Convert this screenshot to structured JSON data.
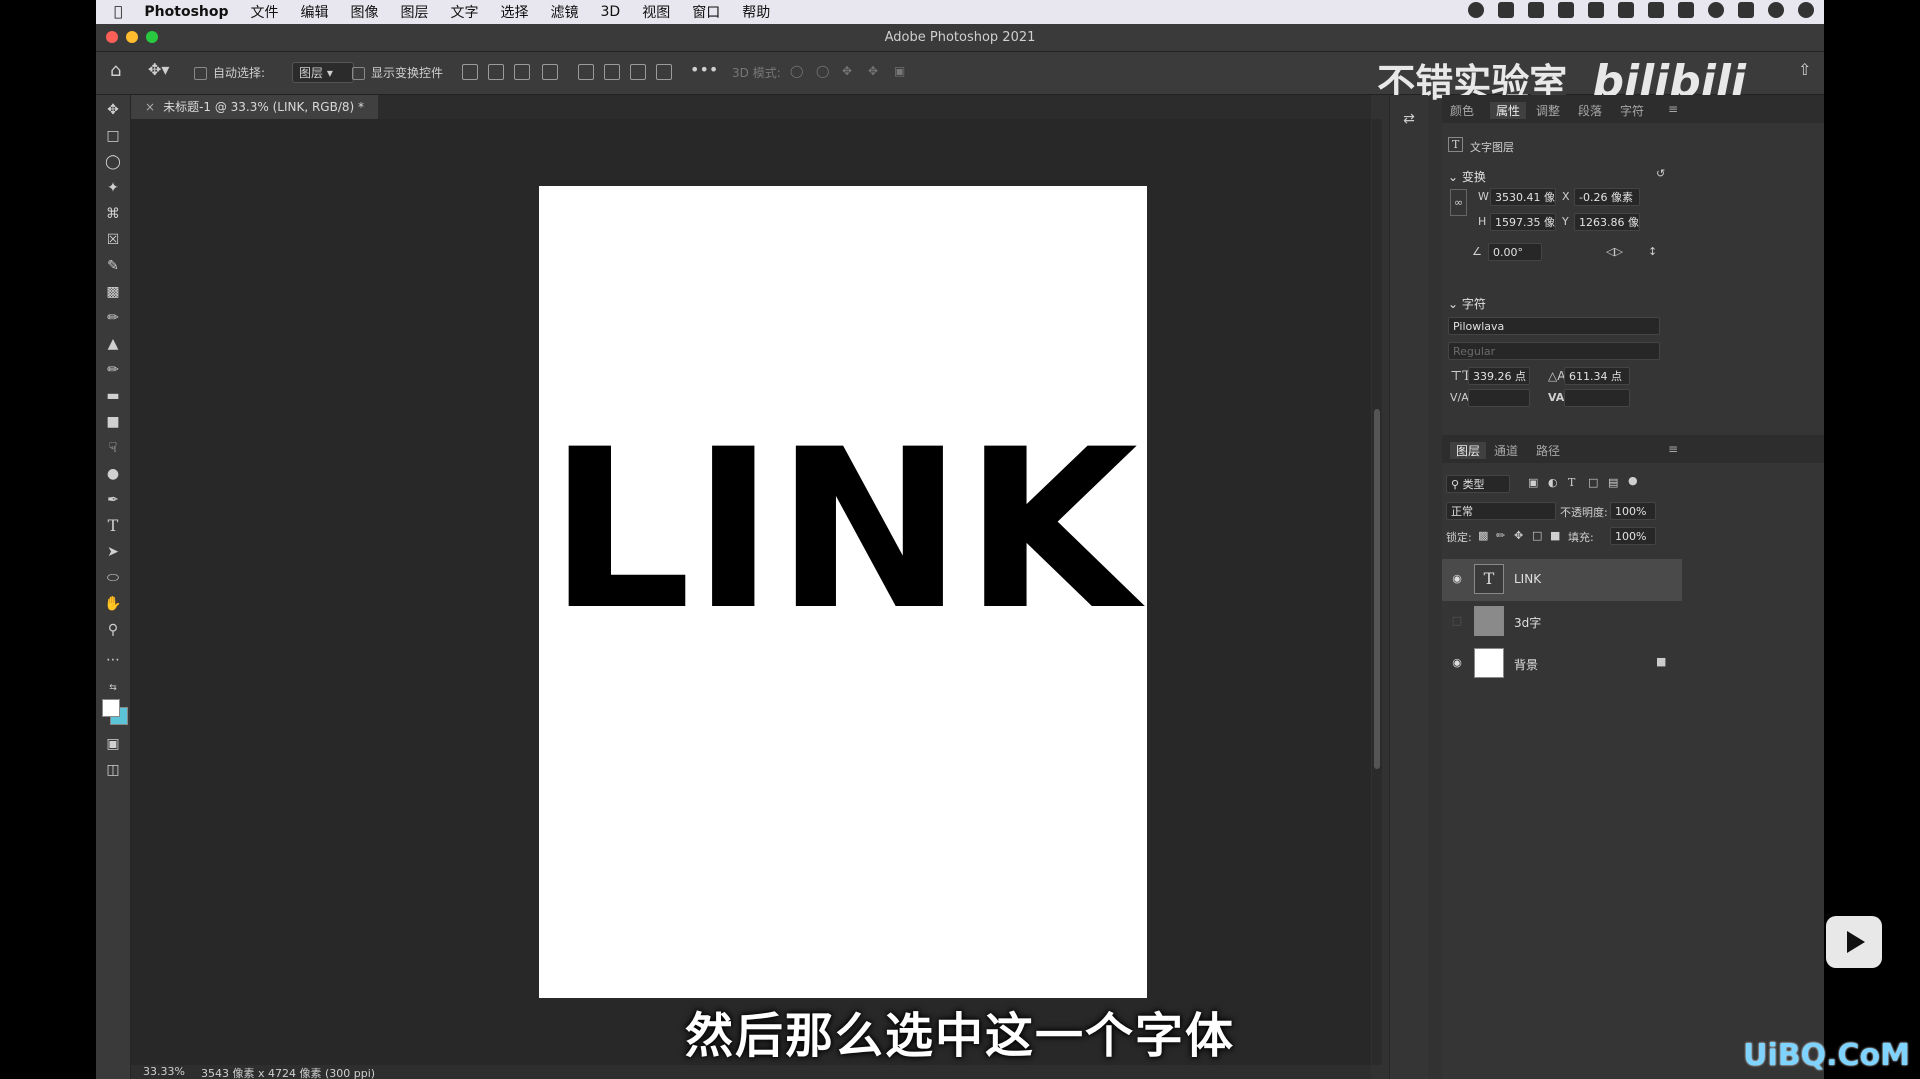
{
  "menubar": {
    "app": "Photoshop",
    "items": [
      "文件",
      "编辑",
      "图像",
      "图层",
      "文字",
      "选择",
      "滤镜",
      "3D",
      "视图",
      "窗口",
      "帮助"
    ]
  },
  "window": {
    "title": "Adobe Photoshop 2021"
  },
  "options": {
    "auto_select_label": "自动选择:",
    "auto_select_value": "图层",
    "show_transform_label": "显示变换控件",
    "mode_3d_label": "3D 模式:"
  },
  "watermark": {
    "channel": "不错实验室",
    "brand": "bilibili"
  },
  "document": {
    "tab_label": "未标题-1 @ 33.3% (LINK, RGB/8) *",
    "canvas_text": "LINK"
  },
  "status": {
    "zoom": "33.33%",
    "info": "3543 像素 x 4724 像素 (300 ppi)"
  },
  "subtitle": "然后那么选中这一个字体",
  "properties": {
    "tabs": [
      "颜色",
      "属性",
      "调整",
      "段落",
      "字符"
    ],
    "active_tab": "属性",
    "layer_kind": "文字图层",
    "transform_title": "变换",
    "w_label": "W",
    "w_value": "3530.41 像素",
    "x_label": "X",
    "x_value": "-0.26 像素",
    "h_label": "H",
    "h_value": "1597.35 像素",
    "y_label": "Y",
    "y_value": "1263.86 像素",
    "angle_value": "0.00°",
    "char_title": "字符",
    "font_family": "Pilowlava",
    "font_style": "Regular",
    "font_size": "339.26 点",
    "leading": "611.34 点",
    "tracking_label": "V/A",
    "kerning_label": "VA"
  },
  "layers": {
    "tabs": [
      "图层",
      "通道",
      "路径"
    ],
    "filter_label": "类型",
    "blend_mode": "正常",
    "opacity_label": "不透明度:",
    "opacity_value": "100%",
    "lock_label": "锁定:",
    "fill_label": "填充:",
    "fill_value": "100%",
    "items": [
      {
        "name": "LINK"
      },
      {
        "name": "3d字"
      },
      {
        "name": "背景"
      }
    ]
  },
  "site_watermark": "UiBQ.CoM",
  "colors": {
    "accent_foreground": "#ffffff",
    "accent_background": "#5bc4d6",
    "panel_bg": "#353535",
    "canvas_bg": "#282828"
  }
}
